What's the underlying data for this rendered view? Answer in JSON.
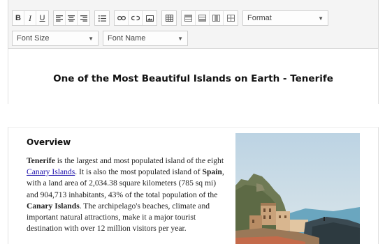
{
  "toolbar": {
    "icons": {
      "bold": "B",
      "italic": "I",
      "underline": "U",
      "align_left": "align-left-icon",
      "align_center": "align-center-icon",
      "align_right": "align-right-icon",
      "bullet_list": "bullet-list-icon",
      "link": "link-icon",
      "unlink": "unlink-icon",
      "image": "image-icon",
      "table": "table-icon",
      "row_insert": "row-insert-icon",
      "row_delete": "row-delete-icon",
      "col_insert": "col-insert-icon",
      "col_delete": "col-delete-icon"
    },
    "format_select": "Format",
    "font_size_select": "Font Size",
    "font_name_select": "Font Name"
  },
  "document": {
    "title": "One of the Most Beautiful Islands on Earth - Tenerife",
    "overview_heading": "Overview",
    "paragraph": {
      "p1": "Tenerife",
      "p2": " is the largest and most populated island of the eight ",
      "link": "Canary Islands",
      "p3": ". It is also the most populated island of ",
      "p4": "Spain",
      "p5": ", with a land area of 2,034.38 square kilometers (785 sq mi) and 904,713 inhabitants, 43% of the total population of the ",
      "p6": "Canary Islands",
      "p7": ". The archipelago's beaches, climate and important natural attractions, make it a major tourist destination with over 12 million visitors per year."
    }
  },
  "colors": {
    "toolbar_bg": "#f4f4f4",
    "link": "#1a0dab",
    "sky": "#c9dde9",
    "sea": "#7fb6c9"
  }
}
